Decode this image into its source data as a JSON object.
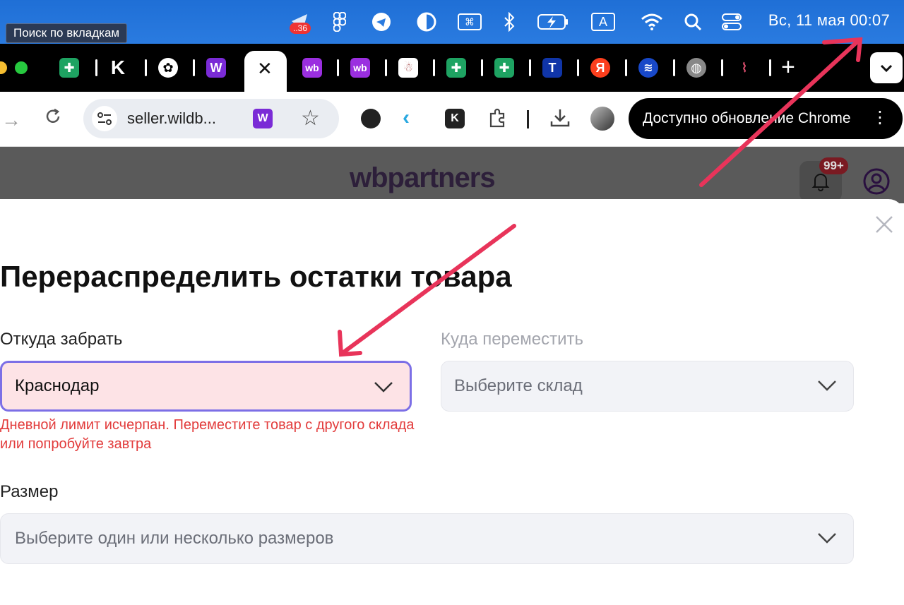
{
  "menubar": {
    "tooltip": "Поиск по вкладкам",
    "badge": "..36",
    "keyboard_layout": "A",
    "clock": "Вс, 11 мая  00:07"
  },
  "tabs": {
    "icons": [
      "sheets-icon",
      "k-icon",
      "openai-icon",
      "w-icon",
      "close-tab-icon",
      "wb-icon",
      "wb-icon",
      "app-icon",
      "sheets-icon",
      "sheets-icon",
      "t-icon",
      "yandex-icon",
      "globe-wave-icon",
      "globe-icon",
      "waveform-icon"
    ],
    "new_tab": "+"
  },
  "toolbar": {
    "url": "seller.wildb...",
    "update_label": "Доступно обновление Chrome"
  },
  "site": {
    "logo": "wbpartners",
    "notif_badge": "99+"
  },
  "modal": {
    "title": "Перераспределить остатки товара",
    "from_label": "Откуда забрать",
    "from_value": "Краснодар",
    "error": "Дневной лимит исчерпан. Переместите товар с другого склада или попробуйте завтра",
    "to_label": "Куда переместить",
    "to_placeholder": "Выберите склад",
    "size_label": "Размер",
    "size_placeholder": "Выберите один или несколько размеров"
  },
  "colors": {
    "menubar": "#2a7be0",
    "error": "#e23c3c",
    "error_field_bg": "#fde3e6",
    "error_field_border": "#7c6fe6",
    "annotation_arrow": "#e8345a"
  }
}
